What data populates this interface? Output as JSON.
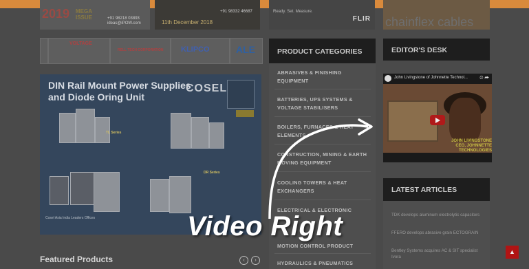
{
  "ads": {
    "mega": {
      "year": "2019",
      "tag_line1": "MEGA",
      "tag_line2": "ISSUE",
      "phone": "+91 98218 03893",
      "email": "ideas@iPOW.com"
    },
    "expo": {
      "date": "11th December 2018",
      "phone": "+91 98332 46687"
    },
    "flir": {
      "logo": "FLIR",
      "text": "Ready. Set. Measure."
    },
    "chainflex": {
      "brand": "chainflex",
      "suffix": "cables"
    }
  },
  "logos": [
    {
      "text": "VOLTAGE",
      "color": "#b04040"
    },
    {
      "text": "RELL TECH CORPORATION",
      "color": "#b04040"
    },
    {
      "text": "KLIPCO",
      "color": "#3050a0"
    },
    {
      "text": "ALE",
      "color": "#3060a0"
    }
  ],
  "banner": {
    "headline_line1": "DIN Rail Mount Power Supplies",
    "headline_line2": "and Diode Oring Unit",
    "brand": "COSEL",
    "series_a": "TL Series",
    "series_b": "DR Series",
    "footer": "Cosel Asia India Leaders Offices"
  },
  "featured": {
    "title": "Featured Products"
  },
  "product_categories": {
    "heading": "PRODUCT CATEGORIES",
    "items": [
      "ABRASIVES & FINISHING EQUIPMENT",
      "BATTERIES, UPS SYSTEMS & VOLTAGE STABILISERS",
      "BOILERS, FURNACES & HEAT ELEMENTS",
      "CONSTRUCTION, MINING & EARTH MOVING EQUIPMENT",
      "COOLING TOWERS & HEAT EXCHANGERS",
      "ELECTRICAL & ELECTRONIC",
      "MOTION CONTROL PRODUCT",
      "HYDRAULICS & PNEUMATICS"
    ]
  },
  "editors_desk": {
    "heading": "EDITOR'S DESK",
    "video_title": "John Livingstone of Johnnette Technol...",
    "video_caption_line1": "JOHN LIVINGSTONE",
    "video_caption_line2": "CEO, JOHNNETTE TECHNOLOGIES"
  },
  "latest_articles": {
    "heading": "LATEST ARTICLES",
    "items": [
      "TDK develops aluminum electrolytic capacitors",
      "FFERO develops abrasive grain ECTOGRAIN",
      "Bentley Systems acquires AC & SIT specialist Ivora"
    ]
  },
  "overlay": {
    "label": "Video Right"
  },
  "colors": {
    "accent": "#d98a3c",
    "scroll_button": "#b01414",
    "panel_header": "#1e1e1e"
  }
}
